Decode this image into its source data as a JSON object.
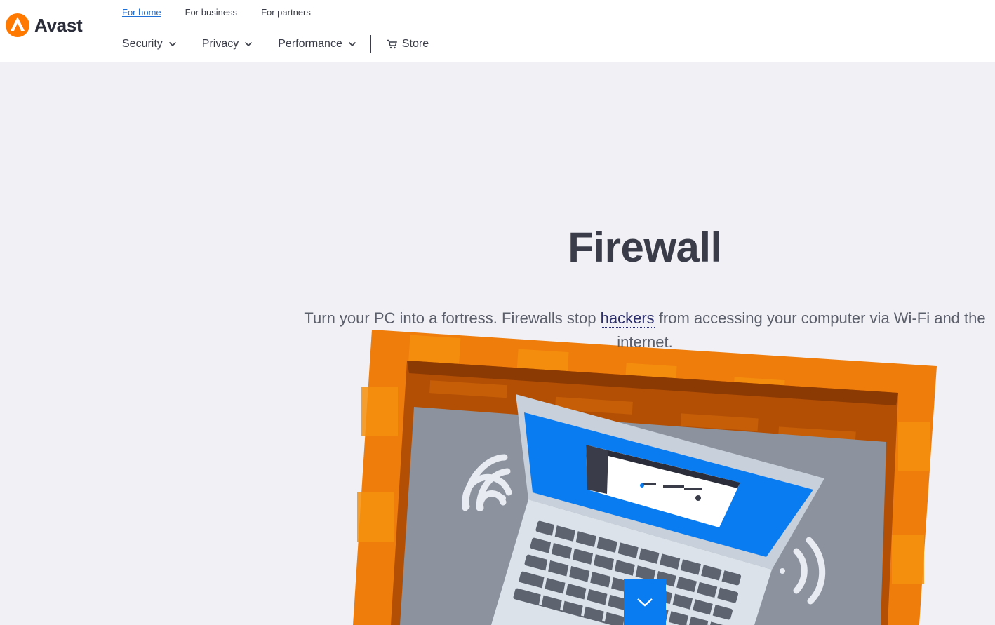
{
  "brand": {
    "name": "Avast",
    "color": "#ff7800"
  },
  "top_nav": [
    {
      "label": "For home",
      "active": true
    },
    {
      "label": "For business",
      "active": false
    },
    {
      "label": "For partners",
      "active": false
    }
  ],
  "main_nav": {
    "items": [
      {
        "label": "Security",
        "icon": "chevron-down-icon"
      },
      {
        "label": "Privacy",
        "icon": "chevron-down-icon"
      },
      {
        "label": "Performance",
        "icon": "chevron-down-icon"
      }
    ],
    "store": {
      "label": "Store",
      "icon": "cart-icon"
    }
  },
  "hero": {
    "title": "Firewall",
    "subtitle_before": "Turn your PC into a fortress. Firewalls stop ",
    "subtitle_link": "hackers",
    "subtitle_after": " from accessing your computer via Wi-Fi and the internet."
  },
  "illustration": {
    "icon": "laptop-firewall-illustration"
  },
  "scroll_button": {
    "icon": "chevron-down-icon",
    "color": "#0a7cf2"
  }
}
